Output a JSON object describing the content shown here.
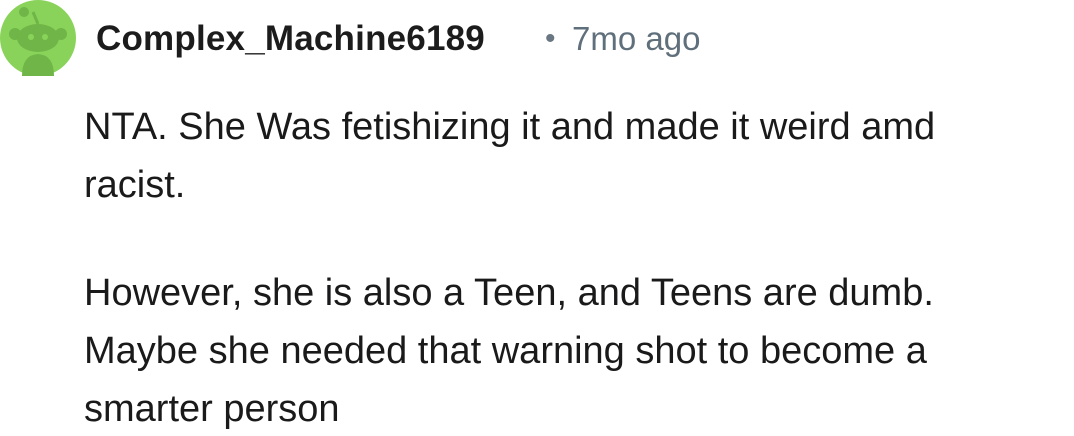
{
  "comment": {
    "author": "Complex_Machine6189",
    "separator": "•",
    "timestamp": "7mo ago",
    "avatar_icon": "reddit-snoo-avatar-icon",
    "avatar_color": "#8ad35b",
    "paragraphs": [
      "NTA. She Was fetishizing it and made it weird amd\nracist.",
      "However, she is also a Teen, and Teens are dumb.\nMaybe she needed that warning shot to become a\nsmarter person"
    ]
  }
}
